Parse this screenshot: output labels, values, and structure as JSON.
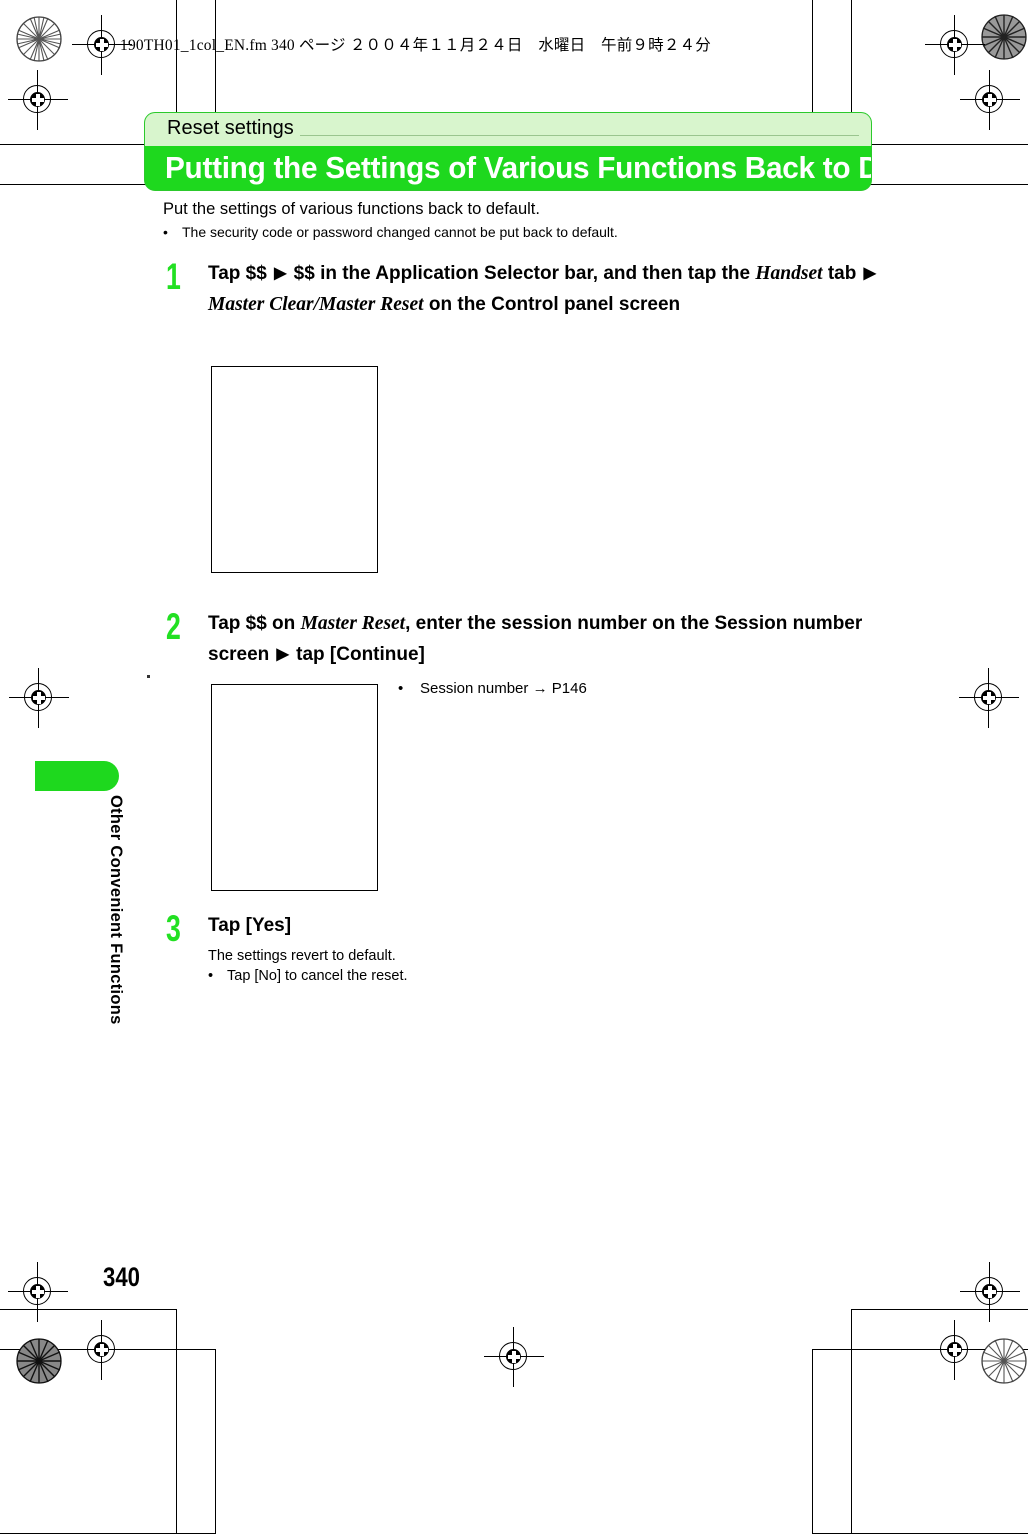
{
  "page": {
    "file_header": "190TH01_1col_EN.fm  340 ページ  ２００４年１１月２４日　水曜日　午前９時２４分",
    "page_number": "340",
    "chapter_tab_label": "Other Convenient Functions"
  },
  "banner": {
    "eyebrow": "Reset settings",
    "title": "Putting the Settings of Various Functions Back to Default",
    "accent_color": "#1ed81e",
    "eyebrow_bg": "#d8f5cd"
  },
  "intro": {
    "lead": "Put the settings of various functions back to default.",
    "bullet": "•",
    "note": "The security code or password changed cannot be put back to default."
  },
  "steps": [
    {
      "number": "1",
      "line1_a": "Tap $$ ",
      "line1_arrow": "▶",
      "line1_b": " $$ in the Application Selector bar, and then tap the",
      "line2_italic_a": "Handset",
      "line2_b": " tab ",
      "line2_arrow": "▶",
      "line2_italic_c": "Master Clear/Master Reset",
      "line2_d": " on the Control panel",
      "line3": "screen"
    },
    {
      "number": "2",
      "line1_a": "Tap $$ on ",
      "line1_italic": "Master Reset",
      "line1_b": ", enter the session number on the Session",
      "line2_a": "number screen ",
      "line2_arrow": "▶",
      "line2_b": " tap [Continue]"
    },
    {
      "number": "3",
      "heading": "Tap [Yes]",
      "detail": "The settings revert to default.",
      "bullet": "•",
      "note": "Tap [No] to cancel the reset."
    }
  ],
  "annotations": {
    "session_bullet": "•",
    "session_text": "Session number",
    "session_arrow": "→",
    "session_ref": "P146"
  },
  "icons": {
    "arrow_right_triangle": "▶",
    "arrow_right_line": "→"
  }
}
